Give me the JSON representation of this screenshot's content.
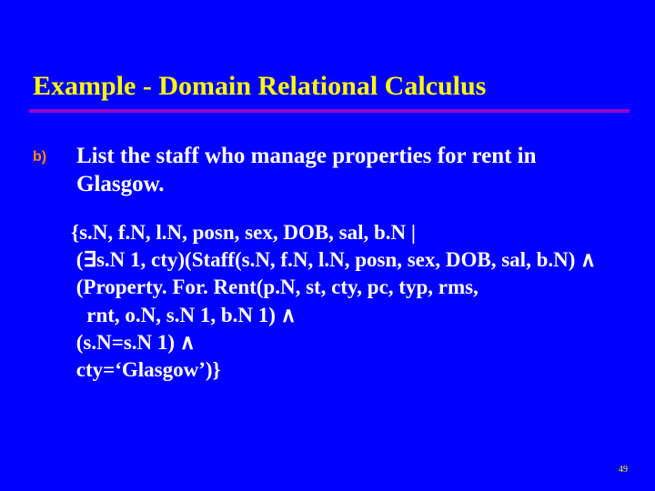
{
  "slide": {
    "title": "Example - Domain Relational Calculus",
    "bullet_label": "b)",
    "bullet_text": "List the staff who manage properties for rent in Glasgow.",
    "formula": {
      "l1": "{s.N, f.N, l.N, posn, sex, DOB, sal, b.N |",
      "l2": " (∃s.N 1, cty)(Staff(s.N, f.N, l.N, posn, sex, DOB, sal, b.N) ∧",
      "l3": " (Property. For. Rent(p.N, st, cty, pc, typ, rms,",
      "l4": "   rnt, o.N, s.N 1, b.N 1) ∧",
      "l5": " (s.N=s.N 1) ∧",
      "l6": " cty=‘Glasgow’)}"
    },
    "page_number": "49"
  }
}
